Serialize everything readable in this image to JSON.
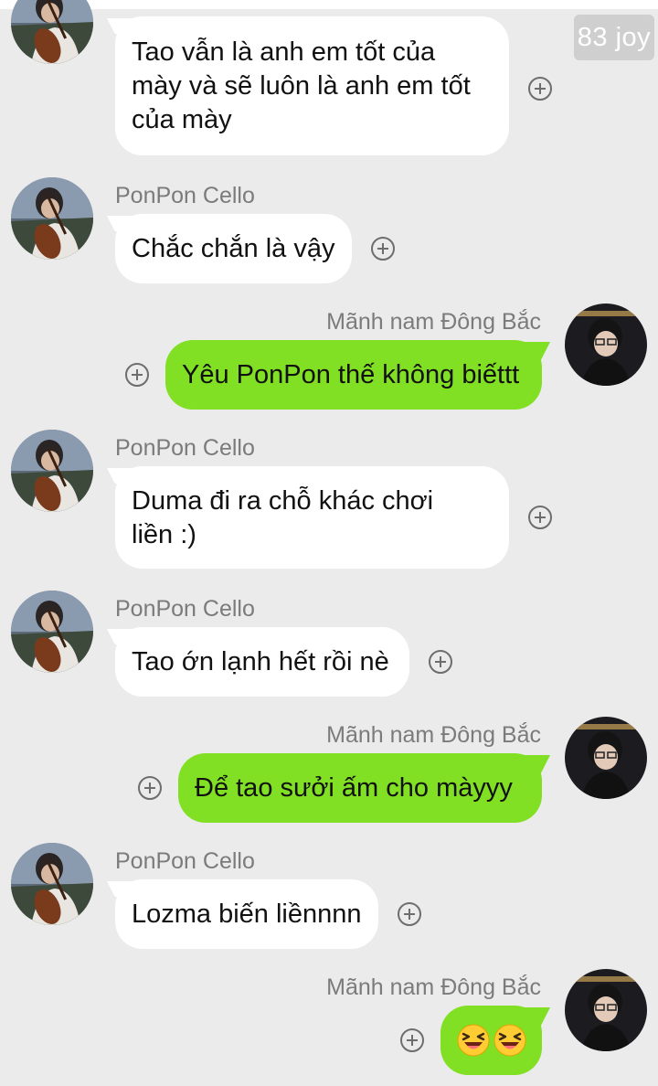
{
  "watermark": "83 joy",
  "colors": {
    "background": "#ebebeb",
    "incoming_bubble": "#ffffff",
    "outgoing_bubble": "#81e024",
    "sender_name": "#7b7b7b"
  },
  "icons": {
    "add_reaction": "plus-circle-icon",
    "emoji": "laughing-face-icon"
  },
  "messages": [
    {
      "direction": "incoming",
      "sender": "",
      "lines": [
        "Tao vẫn là anh em tốt của",
        "mày và sẽ luôn là anh em tốt",
        "của mày"
      ]
    },
    {
      "direction": "incoming",
      "sender": "PonPon Cello",
      "lines": [
        "Chắc chắn là vậy"
      ]
    },
    {
      "direction": "outgoing",
      "sender": "Mãnh nam Đông Bắc",
      "lines": [
        "Yêu PonPon thế không biếttt"
      ]
    },
    {
      "direction": "incoming",
      "sender": "PonPon Cello",
      "lines": [
        "Duma đi ra chỗ khác chơi",
        "liền :)"
      ]
    },
    {
      "direction": "incoming",
      "sender": "PonPon Cello",
      "lines": [
        "Tao ớn lạnh hết rồi nè"
      ]
    },
    {
      "direction": "outgoing",
      "sender": "Mãnh nam Đông Bắc",
      "lines": [
        "Để tao sưởi ấm cho màyyy"
      ]
    },
    {
      "direction": "incoming",
      "sender": "PonPon Cello",
      "lines": [
        "Lozma biến liềnnnn"
      ]
    },
    {
      "direction": "outgoing",
      "sender": "Mãnh nam Đông Bắc",
      "lines": [],
      "emoji_count": 2
    }
  ]
}
